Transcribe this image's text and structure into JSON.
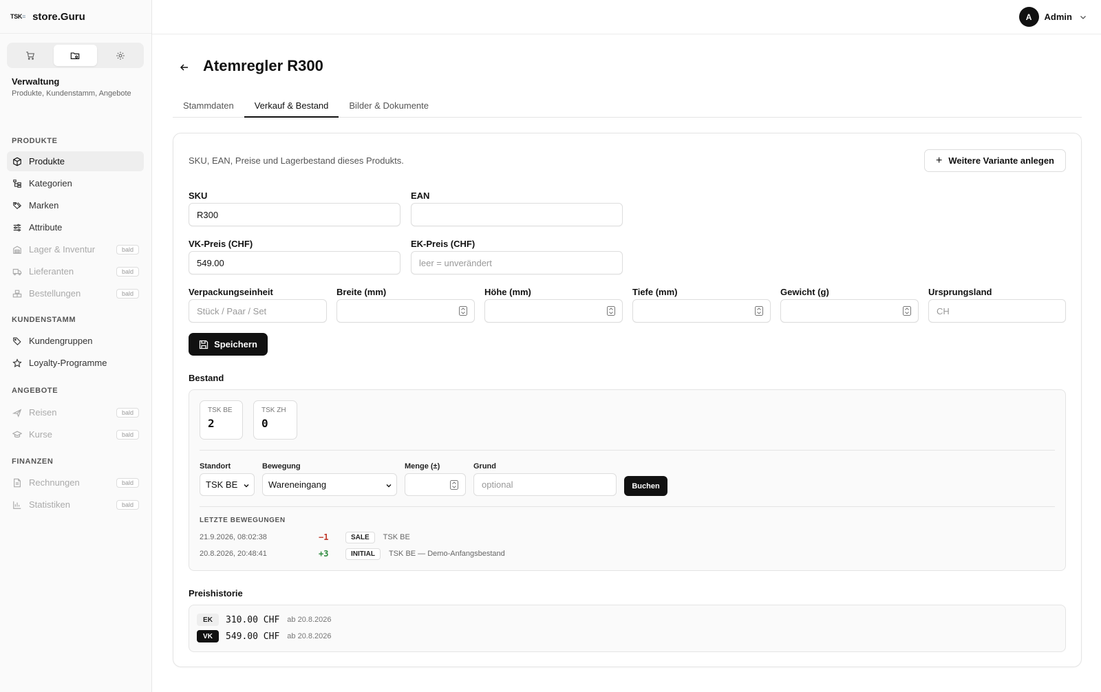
{
  "brand": {
    "logo": "TSK",
    "logo_mark": "≡",
    "name": "store.Guru"
  },
  "sidebar": {
    "section_title": "Verwaltung",
    "section_desc": "Produkte, Kundenstamm, Angebote",
    "groups": [
      {
        "label": "PRODUKTE"
      },
      {
        "label": "KUNDENSTAMM"
      },
      {
        "label": "ANGEBOTE"
      },
      {
        "label": "FINANZEN"
      }
    ],
    "items": [
      {
        "label": "Produkte",
        "icon": "box-icon"
      },
      {
        "label": "Kategorien",
        "icon": "tree-icon"
      },
      {
        "label": "Marken",
        "icon": "tags-icon"
      },
      {
        "label": "Attribute",
        "icon": "sliders-icon"
      },
      {
        "label": "Lager & Inventur",
        "icon": "warehouse-icon",
        "badge": "bald"
      },
      {
        "label": "Lieferanten",
        "icon": "truck-icon",
        "badge": "bald"
      },
      {
        "label": "Bestellungen",
        "icon": "boxes-icon",
        "badge": "bald"
      },
      {
        "label": "Kundengruppen",
        "icon": "tag-icon"
      },
      {
        "label": "Loyalty-Programme",
        "icon": "star-icon"
      },
      {
        "label": "Reisen",
        "icon": "plane-icon",
        "badge": "bald"
      },
      {
        "label": "Kurse",
        "icon": "graduation-icon",
        "badge": "bald"
      },
      {
        "label": "Rechnungen",
        "icon": "invoice-icon",
        "badge": "bald"
      },
      {
        "label": "Statistiken",
        "icon": "chart-icon",
        "badge": "bald"
      }
    ]
  },
  "header": {
    "avatar_initial": "A",
    "user_name": "Admin"
  },
  "page": {
    "title": "Atemregler R300"
  },
  "tabs": [
    {
      "label": "Stammdaten"
    },
    {
      "label": "Verkauf & Bestand"
    },
    {
      "label": "Bilder & Dokumente"
    }
  ],
  "card": {
    "description": "SKU, EAN, Preise und Lagerbestand dieses Produkts.",
    "add_variant_label": "Weitere Variante anlegen"
  },
  "form": {
    "sku": {
      "label": "SKU",
      "value": "R300"
    },
    "ean": {
      "label": "EAN",
      "value": ""
    },
    "vk": {
      "label": "VK-Preis (CHF)",
      "value": "549.00"
    },
    "ek": {
      "label": "EK-Preis (CHF)",
      "placeholder": "leer = unverändert"
    },
    "unit": {
      "label": "Verpackungseinheit",
      "placeholder": "Stück / Paar / Set"
    },
    "width": {
      "label": "Breite (mm)"
    },
    "height": {
      "label": "Höhe (mm)"
    },
    "depth": {
      "label": "Tiefe (mm)"
    },
    "weight": {
      "label": "Gewicht (g)"
    },
    "origin": {
      "label": "Ursprungsland",
      "placeholder": "CH"
    },
    "save_label": "Speichern"
  },
  "stock": {
    "title": "Bestand",
    "locations": [
      {
        "name": "TSK BE",
        "qty": "2"
      },
      {
        "name": "TSK ZH",
        "qty": "0"
      }
    ],
    "booking": {
      "location_label": "Standort",
      "location_value": "TSK BE",
      "movement_label": "Bewegung",
      "movement_value": "Wareneingang",
      "qty_label": "Menge (±)",
      "reason_label": "Grund",
      "reason_placeholder": "optional",
      "submit_label": "Buchen"
    },
    "recent_title": "LETZTE BEWEGUNGEN",
    "movements": [
      {
        "date": "21.9.2026, 08:02:38",
        "delta": "−1",
        "type": "SALE",
        "info": "TSK BE"
      },
      {
        "date": "20.8.2026, 20:48:41",
        "delta": "+3",
        "type": "INITIAL",
        "info": "TSK BE — Demo-Anfangsbestand"
      }
    ]
  },
  "price_history": {
    "title": "Preishistorie",
    "entries": [
      {
        "tag": "EK",
        "value": "310.00 CHF",
        "from": "ab 20.8.2026"
      },
      {
        "tag": "VK",
        "value": "549.00 CHF",
        "from": "ab 20.8.2026"
      }
    ]
  }
}
